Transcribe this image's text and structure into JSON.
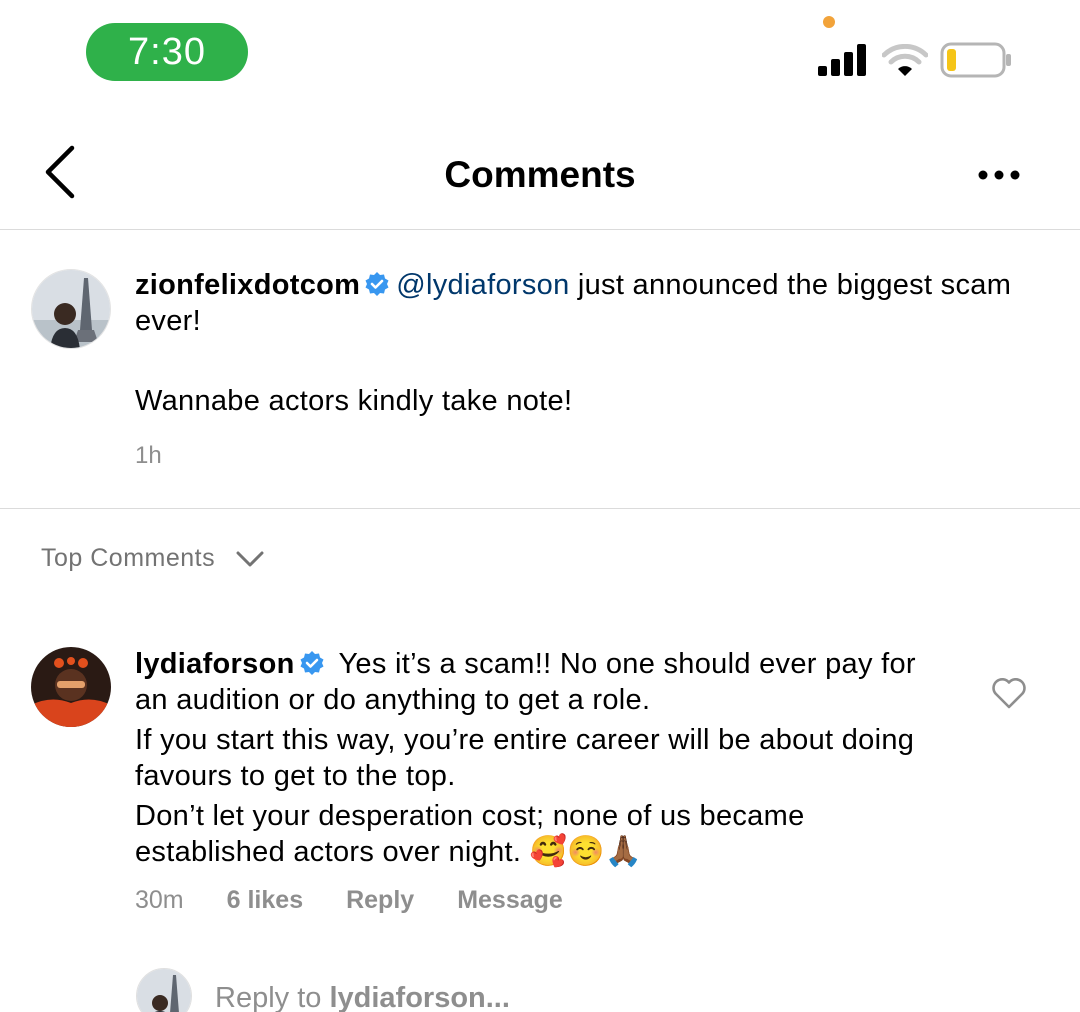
{
  "status": {
    "time": "7:30",
    "colors": {
      "pill": "#2fb14a",
      "dot": "#f2a33a",
      "battery": "#f5c518"
    },
    "icons": [
      "signal-icon",
      "wifi-icon",
      "battery-icon"
    ]
  },
  "header": {
    "title": "Comments",
    "back_icon": "chevron-left-icon",
    "more_icon": "more-dots-icon"
  },
  "post": {
    "username": "zionfelixdotcom",
    "mention": "@lydiaforson",
    "text_part1": " just announced the biggest scam ever!",
    "text_part2": "Wannabe actors kindly take note!",
    "time": "1h"
  },
  "sort": {
    "label": "Top Comments"
  },
  "comment": {
    "username": "lydiaforson",
    "para1": " Yes it’s a scam!! No one should ever pay for an audition or do anything to get a role.",
    "para2": "If you start this way, you’re entire career will be about doing favours to get to the top.",
    "para3": "Don’t let your desperation cost; none of us became established actors over night. ",
    "emojis": "🥰☺️🙏🏾",
    "time": "30m",
    "likes": "6 likes",
    "reply": "Reply",
    "message": "Message"
  },
  "reply_box": {
    "prefix": "Reply to ",
    "target": "lydiaforson..."
  },
  "colors": {
    "mention": "#00376b",
    "verified": "#3897f0",
    "muted": "#8e8e8e"
  }
}
